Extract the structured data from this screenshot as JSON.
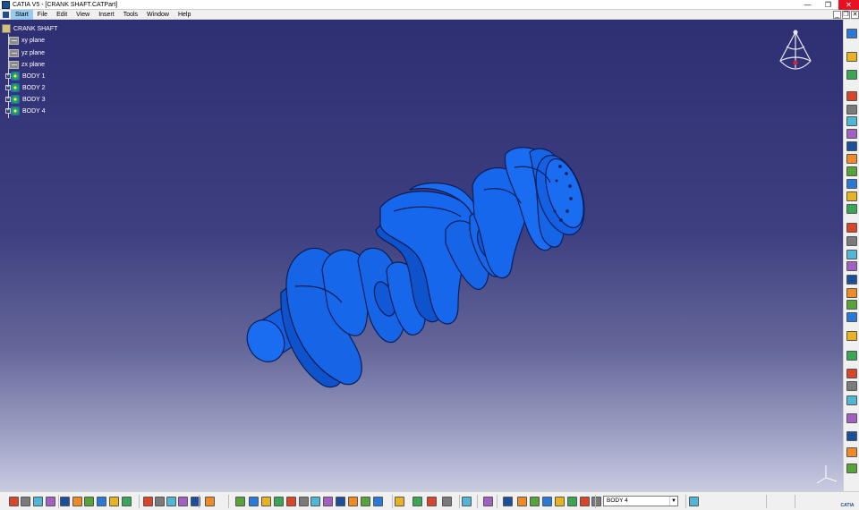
{
  "window": {
    "title": "CATIA V5 - [CRANK SHAFT.CATPart]",
    "minimize": "—",
    "restore": "❐",
    "close": "✕"
  },
  "menu": {
    "items": [
      "Start",
      "File",
      "Edit",
      "View",
      "Insert",
      "Tools",
      "Window",
      "Help"
    ],
    "active": "Start",
    "mdi_buttons": [
      "_",
      "❐",
      "✕"
    ]
  },
  "tree": {
    "root": "CRANK SHAFT",
    "planes": [
      "xy plane",
      "yz plane",
      "zx plane"
    ],
    "bodies": [
      "BODY 1",
      "BODY 2",
      "BODY 3",
      "BODY 4"
    ]
  },
  "toolbar": {
    "current_body": "BODY 4",
    "logo": "CATIA"
  },
  "colors": {
    "viewport_top": "#2e2f73",
    "viewport_bottom": "#c9cbe1",
    "part_fill": "#1565e6",
    "part_edge": "#0a1e5a",
    "close_button": "#e81123"
  },
  "icons": {
    "right_toolbar": [
      "compass-icon",
      "select-arrow-icon",
      "sketch-icon",
      "pad-icon",
      "pocket-icon",
      "shaft-icon",
      "groove-icon",
      "hole-icon",
      "rib-icon",
      "slot-icon",
      "stiffener-icon",
      "loft-icon",
      "fillet-icon",
      "chamfer-icon",
      "draft-icon",
      "shell-icon",
      "thickness-icon",
      "thread-icon",
      "remove-face-icon",
      "replace-face-icon",
      "translate-icon",
      "mirror-icon",
      "pattern-icon",
      "scale-icon",
      "boolean-icon",
      "measure-icon",
      "analysis-icon",
      "constraint-icon",
      "axis-system-icon",
      "more-icon"
    ],
    "bottom_toolbar": [
      "new-icon",
      "open-icon",
      "save-icon",
      "print-icon",
      "cut-icon",
      "copy-icon",
      "paste-icon",
      "undo-icon",
      "redo-icon",
      "whats-this-icon",
      "formula-icon",
      "comment-icon",
      "knowledge-icon",
      "catalog-icon",
      "fly-icon",
      "fit-all-icon",
      "pan-icon",
      "rotate-icon",
      "zoom-in-icon",
      "zoom-out-icon",
      "normal-view-icon",
      "views-icon",
      "render-style-icon",
      "hide-show-icon",
      "swap-space-icon",
      "axis-icon",
      "tools-icon",
      "snap-icon",
      "grid-icon",
      "dimension-icon",
      "constraints-icon",
      "geometric-icon",
      "point-icon",
      "plane-icon",
      "line-icon",
      "body-selector-icon",
      "publish-icon",
      "insert-body-icon",
      "reorder-icon",
      "boolean-add-icon",
      "material-icon",
      "apply-material-icon",
      "photo-studio-icon"
    ]
  }
}
